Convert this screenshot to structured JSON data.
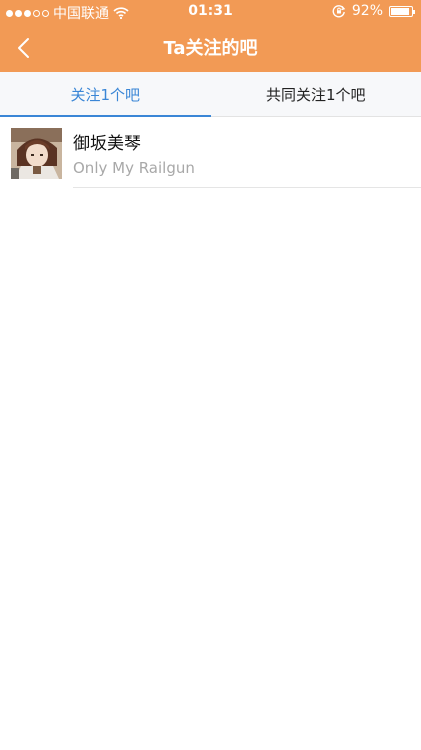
{
  "status_bar": {
    "carrier": "中国联通",
    "time": "01:31",
    "battery_percent": "92%",
    "battery_level": 0.92,
    "signal_dots_filled": 3,
    "signal_dots_total": 5,
    "icons": [
      "signal-icon",
      "wifi-icon",
      "rotation-lock-icon",
      "battery-icon"
    ]
  },
  "nav": {
    "title": "Ta关注的吧",
    "back_icon": "chevron-left-icon"
  },
  "tabs": [
    {
      "label": "关注1个吧",
      "active": true
    },
    {
      "label": "共同关注1个吧",
      "active": false
    }
  ],
  "list": {
    "items": [
      {
        "name": "御坂美琴",
        "subtitle": "Only My Railgun",
        "avatar_icon": "anime-avatar-image"
      }
    ]
  },
  "colors": {
    "header_background": "#f29a55",
    "active_tab": "#3a86d6",
    "tab_bar_background": "#f7f8fa",
    "subtitle_text": "#a8a8a8"
  }
}
